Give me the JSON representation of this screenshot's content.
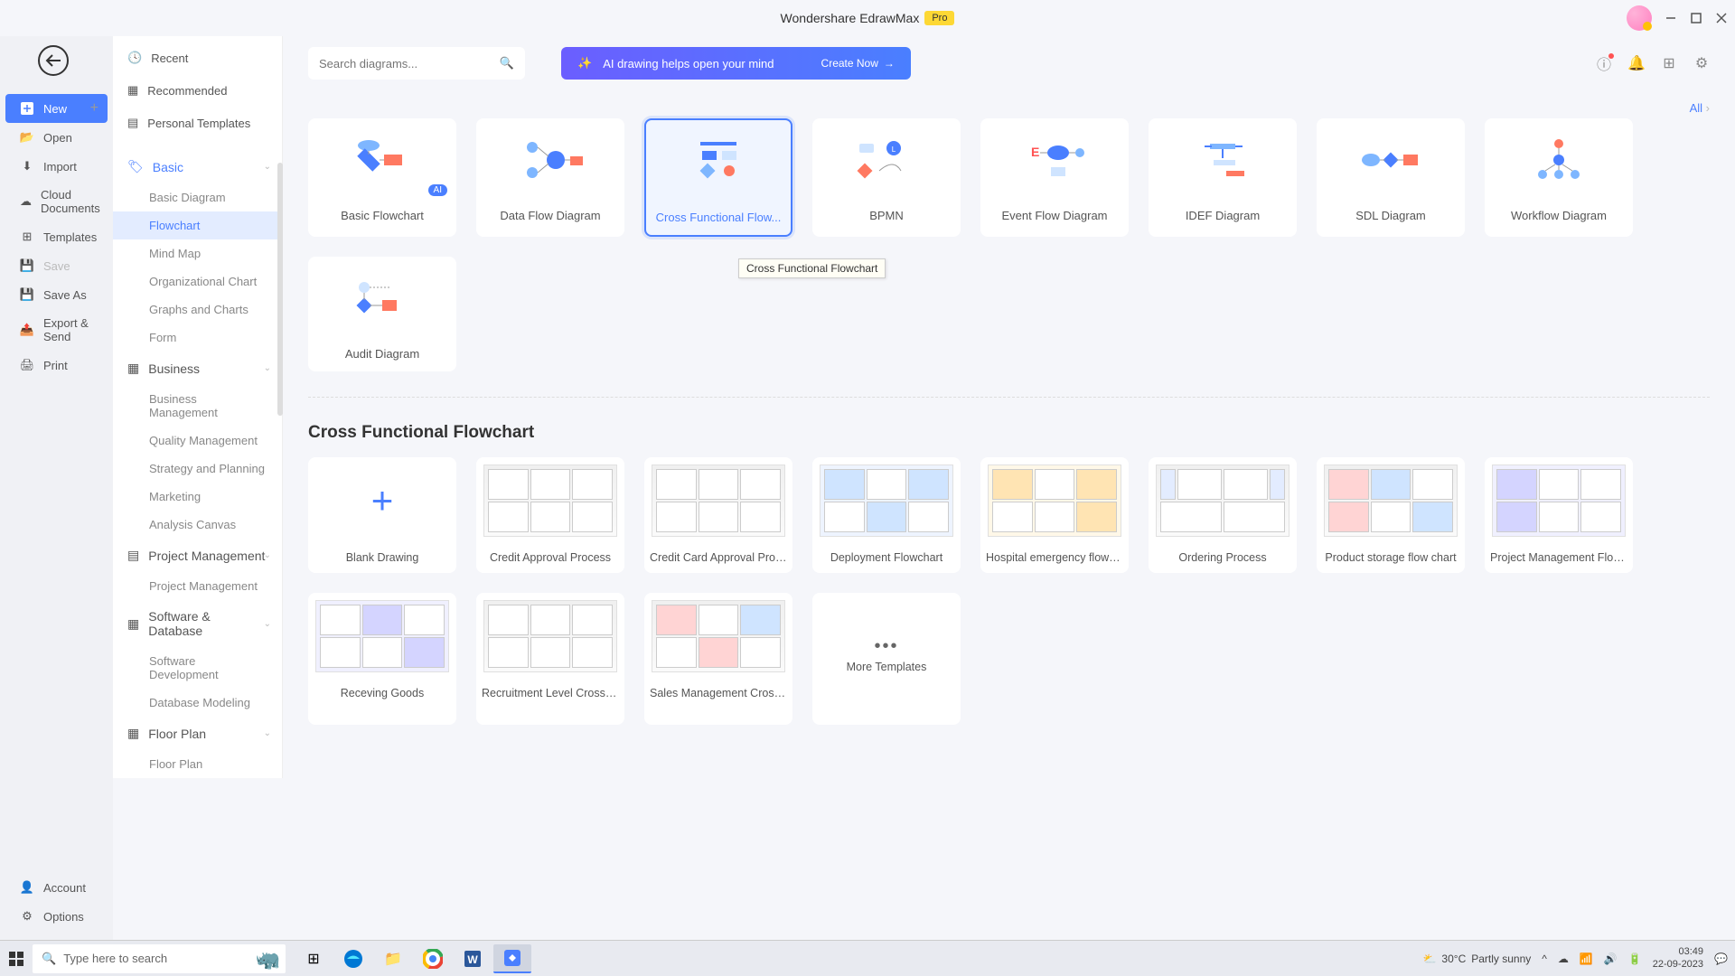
{
  "title": "Wondershare EdrawMax",
  "pro": "Pro",
  "file_menu": {
    "new": "New",
    "open": "Open",
    "import": "Import",
    "cloud": "Cloud Documents",
    "templates": "Templates",
    "save": "Save",
    "save_as": "Save As",
    "export": "Export & Send",
    "print": "Print",
    "account": "Account",
    "options": "Options"
  },
  "nav_top": {
    "recent": "Recent",
    "recommended": "Recommended",
    "personal": "Personal Templates"
  },
  "categories": {
    "basic": {
      "label": "Basic",
      "items": [
        "Basic Diagram",
        "Flowchart",
        "Mind Map",
        "Organizational Chart",
        "Graphs and Charts",
        "Form"
      ]
    },
    "business": {
      "label": "Business",
      "items": [
        "Business Management",
        "Quality Management",
        "Strategy and Planning",
        "Marketing",
        "Analysis Canvas"
      ]
    },
    "pm": {
      "label": "Project Management",
      "items": [
        "Project Management"
      ]
    },
    "sw": {
      "label": "Software & Database",
      "items": [
        "Software Development",
        "Database Modeling"
      ]
    },
    "floor": {
      "label": "Floor Plan",
      "items": [
        "Floor Plan"
      ]
    }
  },
  "search": {
    "placeholder": "Search diagrams..."
  },
  "ai_banner": {
    "text": "AI drawing helps open your mind",
    "cta": "Create Now"
  },
  "all_link": "All",
  "diagram_types": [
    "Basic Flowchart",
    "Data Flow Diagram",
    "Cross Functional Flow...",
    "BPMN",
    "Event Flow Diagram",
    "IDEF Diagram",
    "SDL Diagram",
    "Workflow Diagram",
    "Audit Diagram"
  ],
  "tooltip": "Cross Functional Flowchart",
  "section_title": "Cross Functional Flowchart",
  "templates": [
    "Blank Drawing",
    "Credit Approval Process",
    "Credit Card Approval Proc...",
    "Deployment Flowchart",
    "Hospital emergency flow c...",
    "Ordering Process",
    "Product storage flow chart",
    "Project Management Flow...",
    "Receving Goods",
    "Recruitment Level Cross F...",
    "Sales Management Crossf...",
    "More Templates"
  ],
  "ai_tag": "AI",
  "taskbar": {
    "search": "Type here to search",
    "weather_temp": "30°C",
    "weather_text": "Partly sunny",
    "time": "03:49",
    "date": "22-09-2023"
  }
}
